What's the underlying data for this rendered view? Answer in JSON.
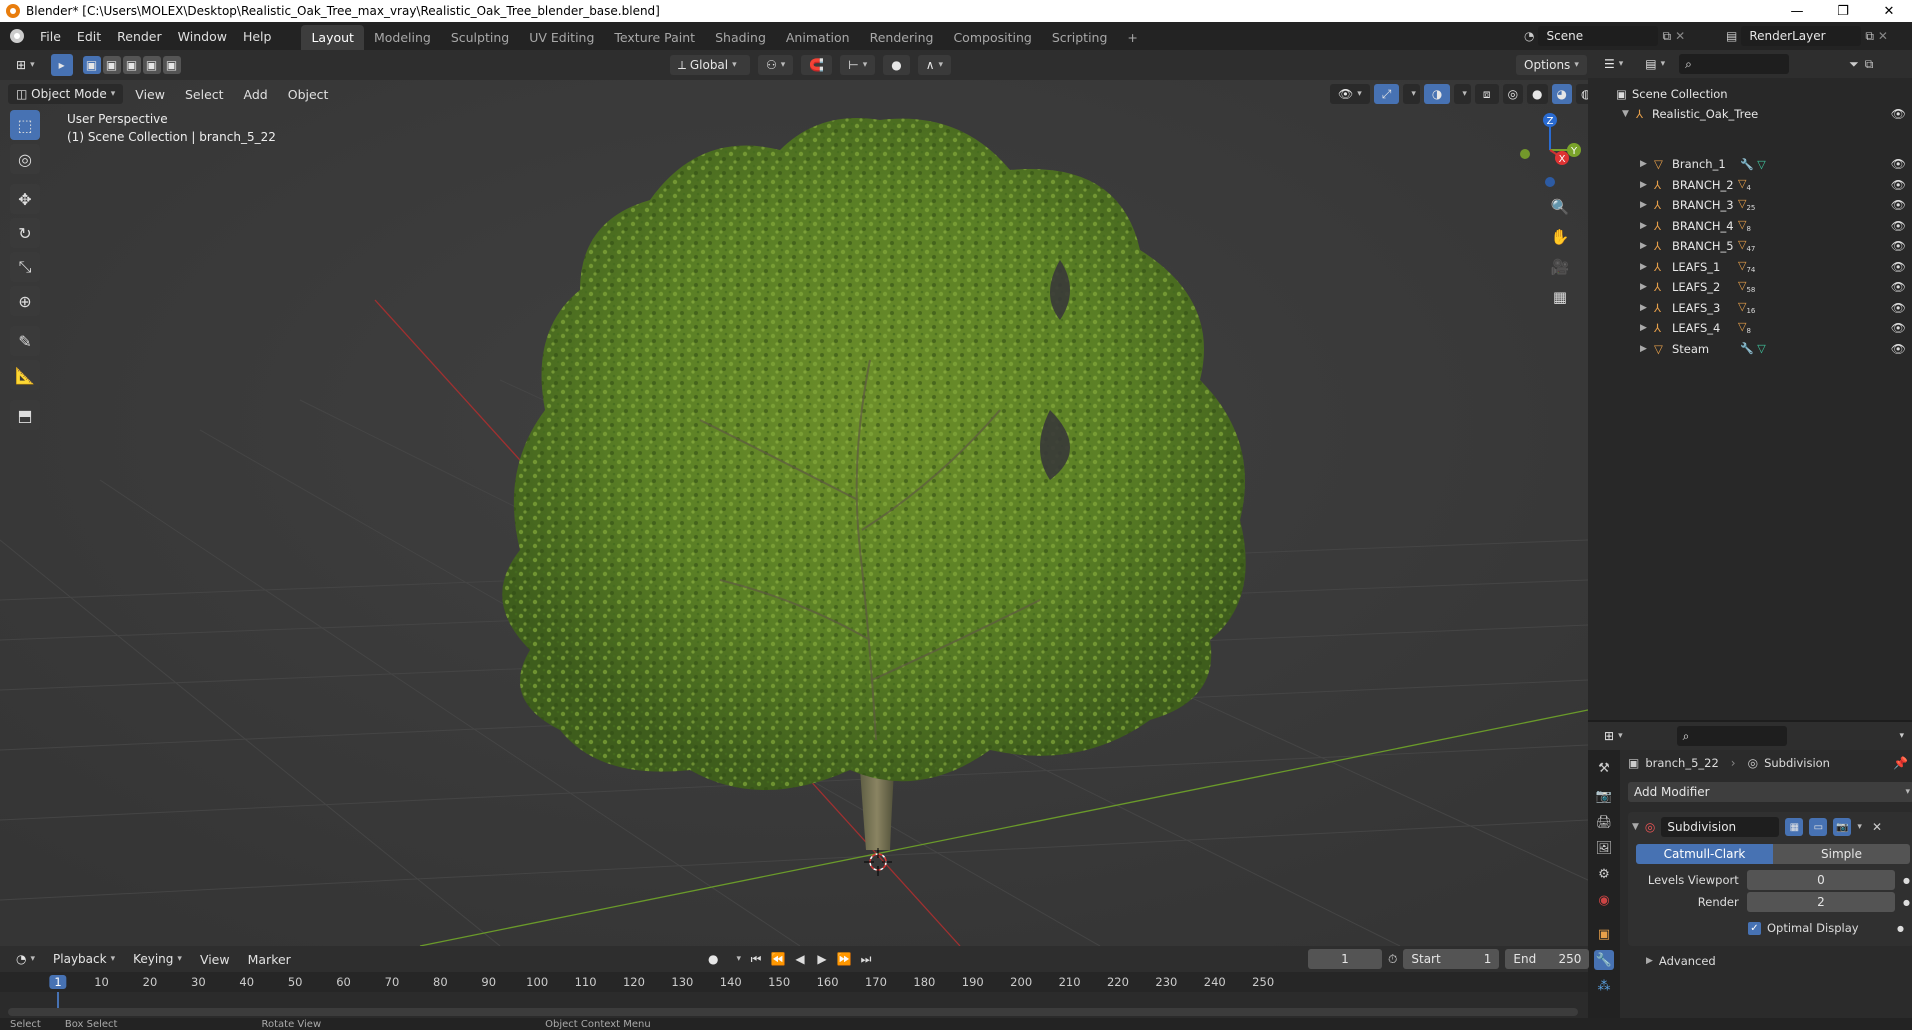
{
  "window": {
    "title": "Blender* [C:\\Users\\MOLEX\\Desktop\\Realistic_Oak_Tree_max_vray\\Realistic_Oak_Tree_blender_base.blend]",
    "minimize": "—",
    "maximize": "❐",
    "close": "✕"
  },
  "menu": {
    "items": [
      "File",
      "Edit",
      "Render",
      "Window",
      "Help"
    ]
  },
  "workspaces": [
    "Layout",
    "Modeling",
    "Sculpting",
    "UV Editing",
    "Texture Paint",
    "Shading",
    "Animation",
    "Rendering",
    "Compositing",
    "Scripting"
  ],
  "workspace_add": "+",
  "scene": {
    "name": "Scene",
    "view_layer": "RenderLayer"
  },
  "toolheader": {
    "orientation": "Global",
    "options": "Options"
  },
  "viewport_header": {
    "mode": "Object Mode",
    "menus": [
      "View",
      "Select",
      "Add",
      "Object"
    ]
  },
  "viewport": {
    "perspective": "User Perspective",
    "collection_info": "(1) Scene Collection | branch_5_22",
    "gizmo": {
      "z": "Z",
      "x": "X",
      "y": "Y"
    }
  },
  "outliner": {
    "root": "Scene Collection",
    "collection": "Realistic_Oak_Tree",
    "objects": [
      {
        "name": "Branch_1",
        "badge": ""
      },
      {
        "name": "BRANCH_2",
        "badge": "4"
      },
      {
        "name": "BRANCH_3",
        "badge": "25"
      },
      {
        "name": "BRANCH_4",
        "badge": "8"
      },
      {
        "name": "BRANCH_5",
        "badge": "47"
      },
      {
        "name": "LEAFS_1",
        "badge": "74"
      },
      {
        "name": "LEAFS_2",
        "badge": "58"
      },
      {
        "name": "LEAFS_3",
        "badge": "16"
      },
      {
        "name": "LEAFS_4",
        "badge": "8"
      },
      {
        "name": "Steam",
        "badge": ""
      }
    ]
  },
  "properties": {
    "object_name": "branch_5_22",
    "modifier_context": "Subdivision",
    "add_modifier": "Add Modifier",
    "modifier_name": "Subdivision",
    "algo_options": [
      "Catmull-Clark",
      "Simple"
    ],
    "levels_viewport_label": "Levels Viewport",
    "levels_viewport_value": "0",
    "render_label": "Render",
    "render_value": "2",
    "optimal_display": "Optimal Display",
    "advanced": "Advanced"
  },
  "timeline": {
    "menus": [
      "Playback",
      "Keying",
      "View",
      "Marker"
    ],
    "current_frame": "1",
    "start_label": "Start",
    "start_value": "1",
    "end_label": "End",
    "end_value": "250",
    "ticks": [
      "1",
      "10",
      "20",
      "30",
      "40",
      "50",
      "60",
      "70",
      "80",
      "90",
      "100",
      "110",
      "120",
      "130",
      "140",
      "150",
      "160",
      "170",
      "180",
      "190",
      "200",
      "210",
      "220",
      "230",
      "240",
      "250"
    ]
  },
  "statusbar": {
    "select": "Select",
    "box_select": "Box Select",
    "rotate": "Rotate View",
    "context": "Object Context Menu"
  },
  "colors": {
    "accent": "#4772b3",
    "orange": "#e87d0d",
    "grid_red": "#a03030",
    "grid_green": "#6a9a2a"
  }
}
